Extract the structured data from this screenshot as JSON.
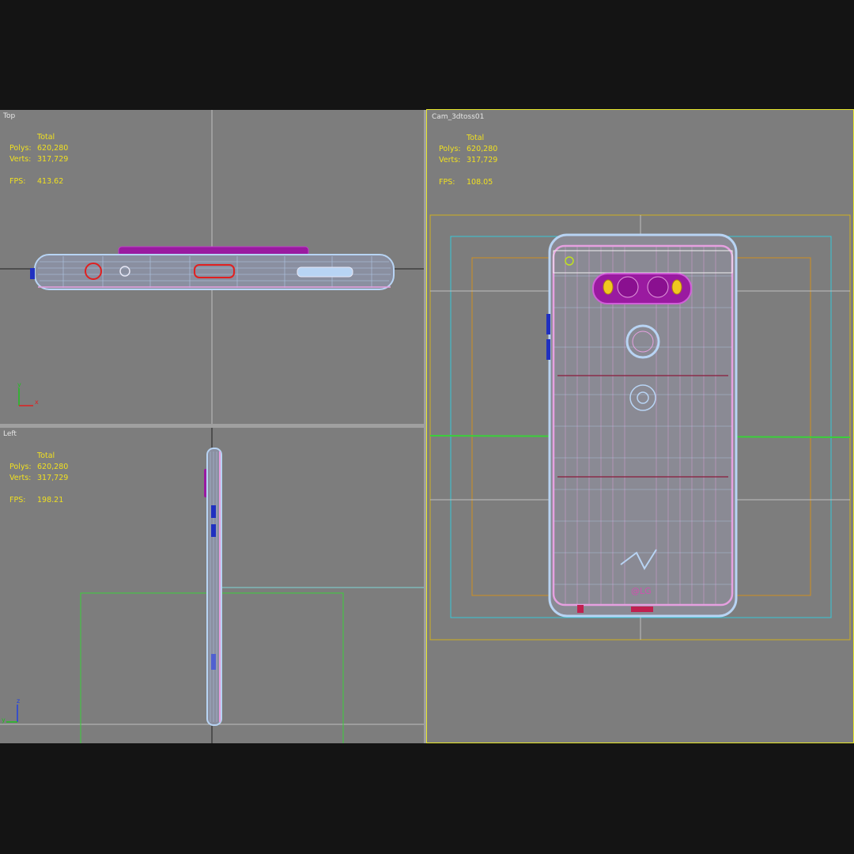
{
  "viewports": {
    "top": {
      "label": "Top",
      "total": "Total",
      "polys_label": "Polys:",
      "polys": "620,280",
      "verts_label": "Verts:",
      "verts": "317,729",
      "fps_label": "FPS:",
      "fps": "413.62"
    },
    "left": {
      "label": "Left",
      "total": "Total",
      "polys_label": "Polys:",
      "polys": "620,280",
      "verts_label": "Verts:",
      "verts": "317,729",
      "fps_label": "FPS:",
      "fps": "198.21"
    },
    "cam": {
      "label": "Cam_3dtoss01",
      "total": "Total",
      "polys_label": "Polys:",
      "polys": "620,280",
      "verts_label": "Verts:",
      "verts": "317,729",
      "fps_label": "FPS:",
      "fps": "108.05"
    }
  },
  "axis_gizmo": {
    "top": {
      "x": "x",
      "y": "y"
    },
    "left": {
      "y": "y",
      "z": "z"
    }
  },
  "colors": {
    "viewport_bg": "#7d7d7d",
    "active_border": "#e6e62a",
    "stats_text": "#f0e020",
    "wire_blue": "#a9c8f0",
    "wire_pink": "#e6a0e0",
    "accent_purple": "#9a1aa0",
    "safe_frame_cyan": "#38c8d8",
    "safe_frame_orange": "#d09020",
    "ground_green": "#3ad03a"
  }
}
